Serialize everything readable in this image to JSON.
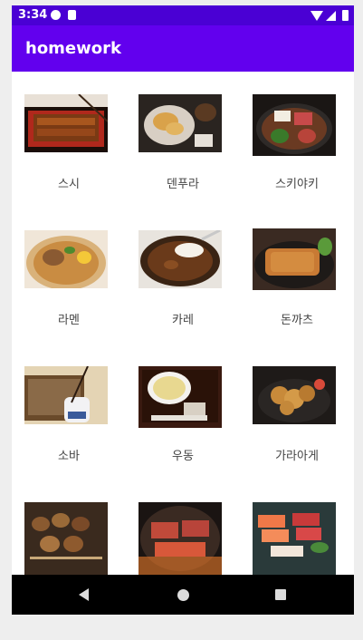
{
  "status_bar": {
    "time": "3:34"
  },
  "app_bar": {
    "title": "homework"
  },
  "foods": [
    {
      "label": "스시",
      "icon": "unagi-don-photo"
    },
    {
      "label": "덴푸라",
      "icon": "tempura-photo"
    },
    {
      "label": "스키야키",
      "icon": "sukiyaki-photo"
    },
    {
      "label": "라멘",
      "icon": "ramen-photo"
    },
    {
      "label": "카레",
      "icon": "curry-photo"
    },
    {
      "label": "돈까츠",
      "icon": "tonkatsu-photo"
    },
    {
      "label": "소바",
      "icon": "soba-photo"
    },
    {
      "label": "우동",
      "icon": "udon-photo"
    },
    {
      "label": "가라아게",
      "icon": "karaage-photo"
    },
    {
      "label": "",
      "icon": "yakitori-photo"
    },
    {
      "label": "",
      "icon": "yakiniku-photo"
    },
    {
      "label": "",
      "icon": "sashimi-photo"
    }
  ],
  "colors": {
    "status_bar": "#4a00d4",
    "app_bar": "#6200ee",
    "nav_bar": "#000000"
  }
}
